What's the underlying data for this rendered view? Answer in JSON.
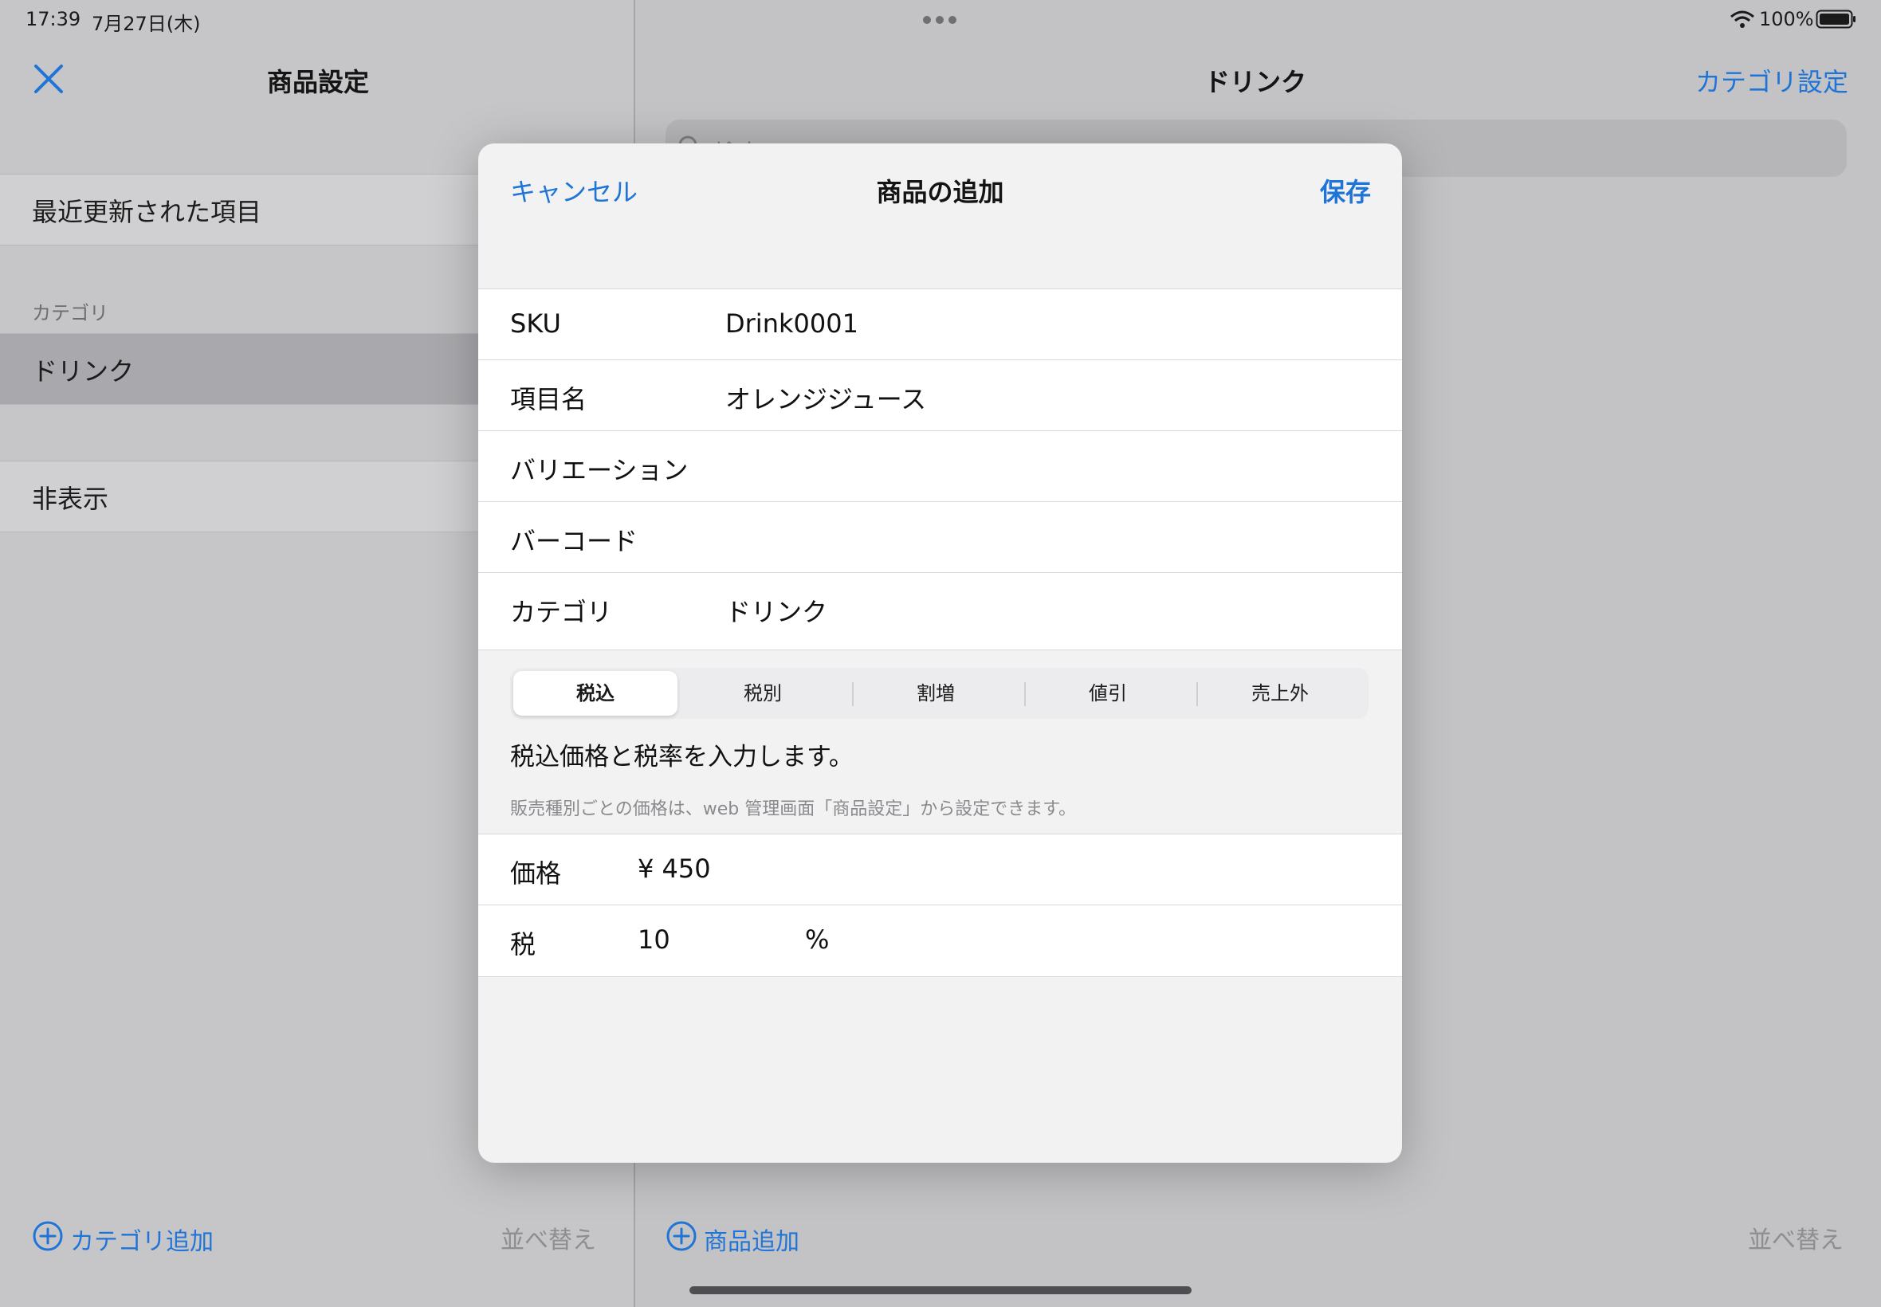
{
  "status_bar": {
    "time": "17:39",
    "date": "7月27日(木)",
    "battery": "100%"
  },
  "sidebar": {
    "title": "商品設定",
    "recent_label": "最近更新された項目",
    "category_section": "カテゴリ",
    "category_items": [
      {
        "label": "ドリンク",
        "selected": true
      }
    ],
    "hidden_label": "非表示",
    "add_category": "カテゴリ追加",
    "sort": "並べ替え"
  },
  "main": {
    "title": "ドリンク",
    "category_settings": "カテゴリ設定",
    "search_placeholder": "検索",
    "add_product": "商品追加",
    "sort": "並べ替え"
  },
  "modal": {
    "cancel": "キャンセル",
    "title": "商品の追加",
    "save": "保存",
    "fields": [
      {
        "label": "SKU",
        "value": "Drink0001"
      },
      {
        "label": "項目名",
        "value": "オレンジジュース"
      },
      {
        "label": "バリエーション",
        "value": ""
      },
      {
        "label": "バーコード",
        "value": ""
      },
      {
        "label": "カテゴリ",
        "value": "ドリンク"
      }
    ],
    "segments": [
      "税込",
      "税別",
      "割増",
      "値引",
      "売上外"
    ],
    "selected_segment": "税込",
    "description": "税込価格と税率を入力します。",
    "note": "販売種別ごとの価格は、web 管理画面「商品設定」から設定できます。",
    "price_label": "価格",
    "price_value": "¥ 450",
    "tax_label": "税",
    "tax_value": "10",
    "tax_unit": "%"
  },
  "colors": {
    "accent": "#1f74d8",
    "modal_bg": "#f2f2f2",
    "dim_bg": "#c4c4c6"
  }
}
